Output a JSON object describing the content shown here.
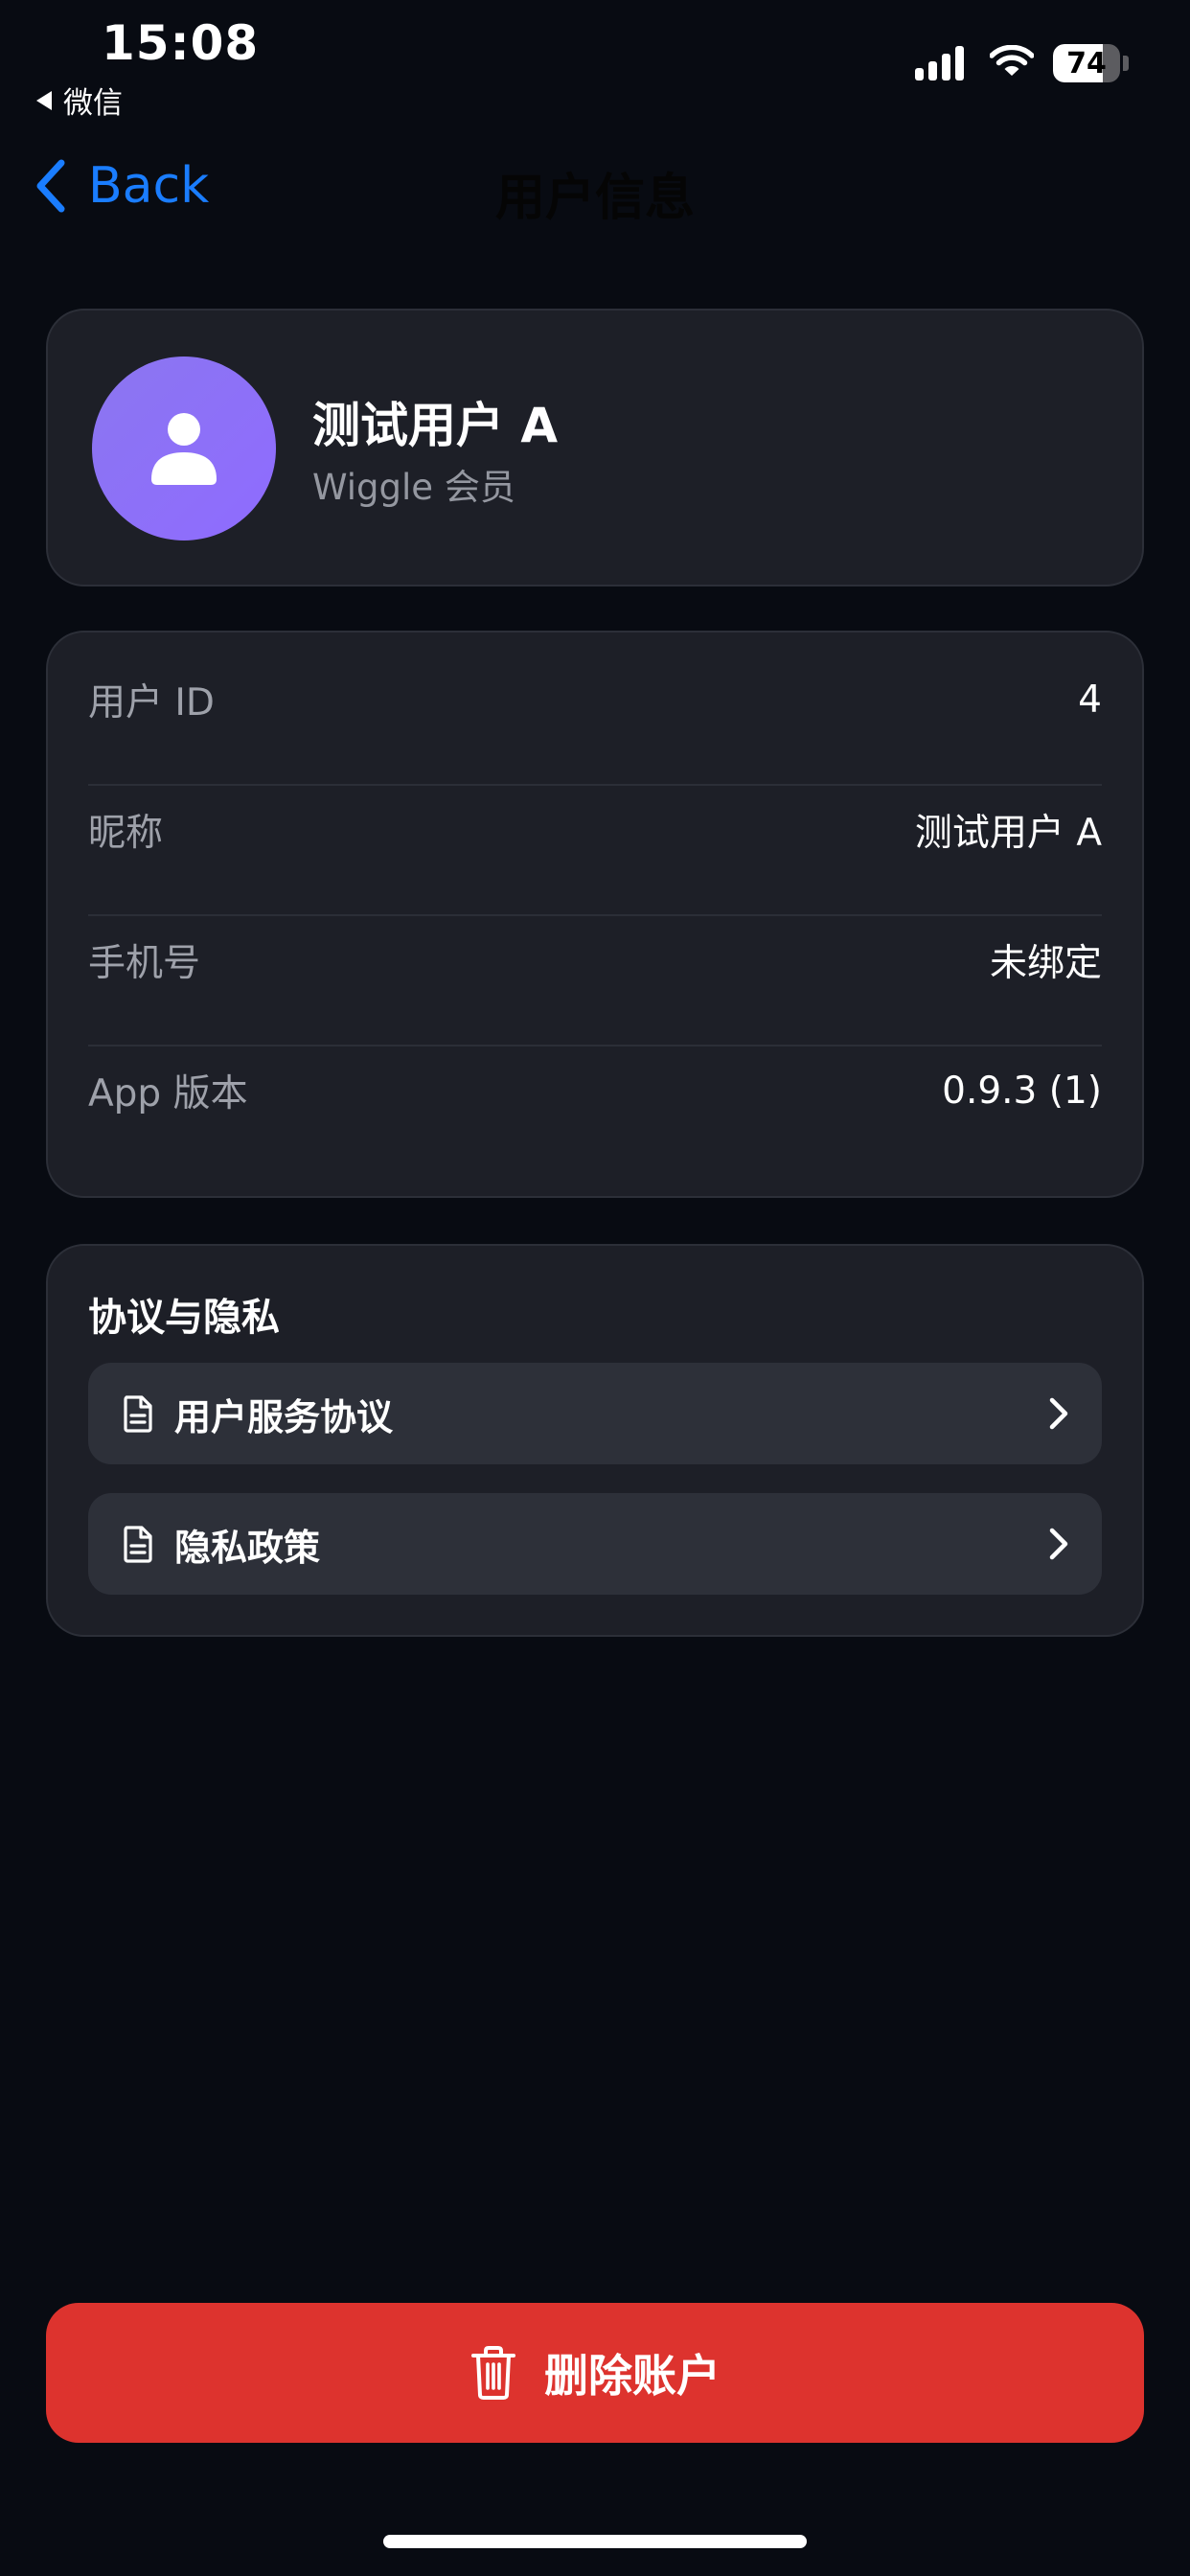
{
  "status_bar": {
    "time": "15:08",
    "back_app": "微信",
    "battery_level": "74",
    "battery_fraction": 0.74
  },
  "nav": {
    "back_label": "Back",
    "title": "用户信息"
  },
  "profile": {
    "name": "测试用户 A",
    "subtitle": "Wiggle 会员",
    "avatar_icon": "person-icon",
    "avatar_color": "#8b76f0"
  },
  "info": {
    "rows": [
      {
        "label": "用户 ID",
        "value": "4"
      },
      {
        "label": "昵称",
        "value": "测试用户 A"
      },
      {
        "label": "手机号",
        "value": "未绑定"
      },
      {
        "label": "App 版本",
        "value": "0.9.3 (1)"
      }
    ]
  },
  "policy": {
    "title": "协议与隐私",
    "items": [
      {
        "label": "用户服务协议",
        "icon": "document-icon"
      },
      {
        "label": "隐私政策",
        "icon": "document-icon"
      }
    ]
  },
  "delete_button": {
    "label": "删除账户",
    "icon": "trash-icon",
    "color": "#dd332e"
  },
  "colors": {
    "background": "#080b12",
    "card": "#1d1f27",
    "accent": "#1a7dff"
  }
}
